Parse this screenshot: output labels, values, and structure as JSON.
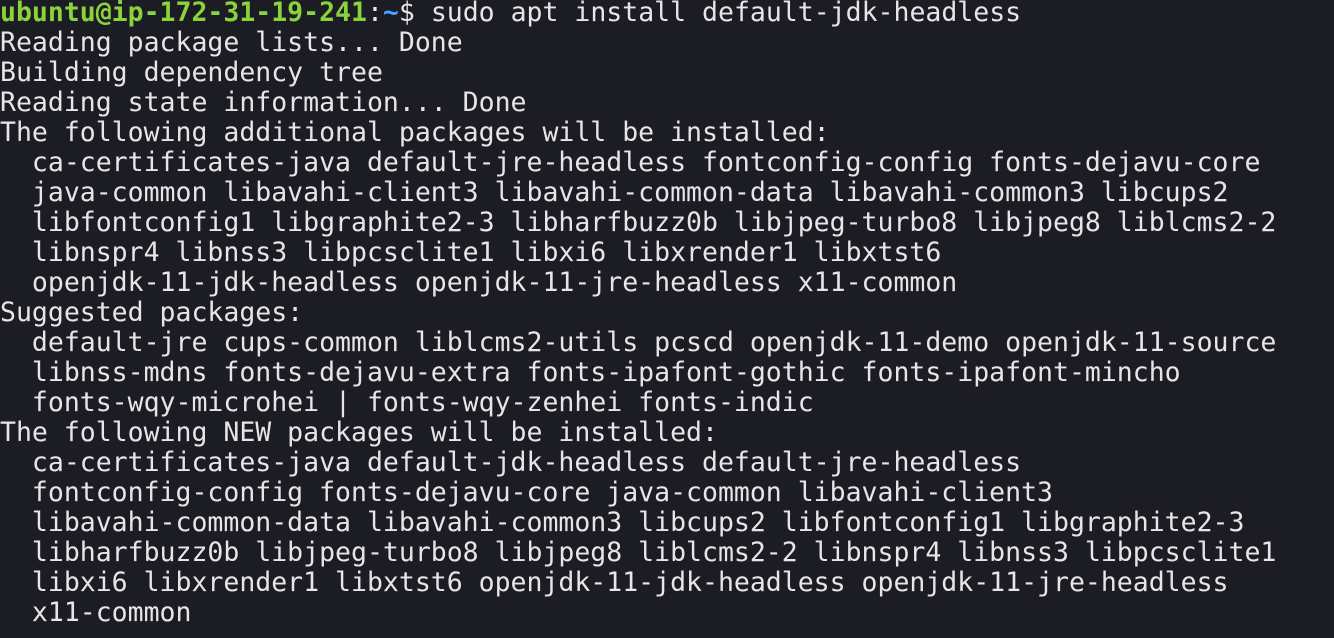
{
  "prompt": {
    "user_host": "ubuntu@ip-172-31-19-241",
    "separator": ":",
    "path": "~",
    "symbol": "$",
    "command": " sudo apt install default-jdk-headless"
  },
  "output": [
    "Reading package lists... Done",
    "Building dependency tree",
    "Reading state information... Done",
    "The following additional packages will be installed:",
    "  ca-certificates-java default-jre-headless fontconfig-config fonts-dejavu-core",
    "  java-common libavahi-client3 libavahi-common-data libavahi-common3 libcups2",
    "  libfontconfig1 libgraphite2-3 libharfbuzz0b libjpeg-turbo8 libjpeg8 liblcms2-2",
    "  libnspr4 libnss3 libpcsclite1 libxi6 libxrender1 libxtst6",
    "  openjdk-11-jdk-headless openjdk-11-jre-headless x11-common",
    "Suggested packages:",
    "  default-jre cups-common liblcms2-utils pcscd openjdk-11-demo openjdk-11-source",
    "  libnss-mdns fonts-dejavu-extra fonts-ipafont-gothic fonts-ipafont-mincho",
    "  fonts-wqy-microhei | fonts-wqy-zenhei fonts-indic",
    "The following NEW packages will be installed:",
    "  ca-certificates-java default-jdk-headless default-jre-headless",
    "  fontconfig-config fonts-dejavu-core java-common libavahi-client3",
    "  libavahi-common-data libavahi-common3 libcups2 libfontconfig1 libgraphite2-3",
    "  libharfbuzz0b libjpeg-turbo8 libjpeg8 liblcms2-2 libnspr4 libnss3 libpcsclite1",
    "  libxi6 libxrender1 libxtst6 openjdk-11-jdk-headless openjdk-11-jre-headless",
    "  x11-common"
  ],
  "colors": {
    "background": "#1c1c24",
    "text": "#e6e6e6",
    "user_host": "#8ad33a",
    "path": "#4aa3ff"
  }
}
